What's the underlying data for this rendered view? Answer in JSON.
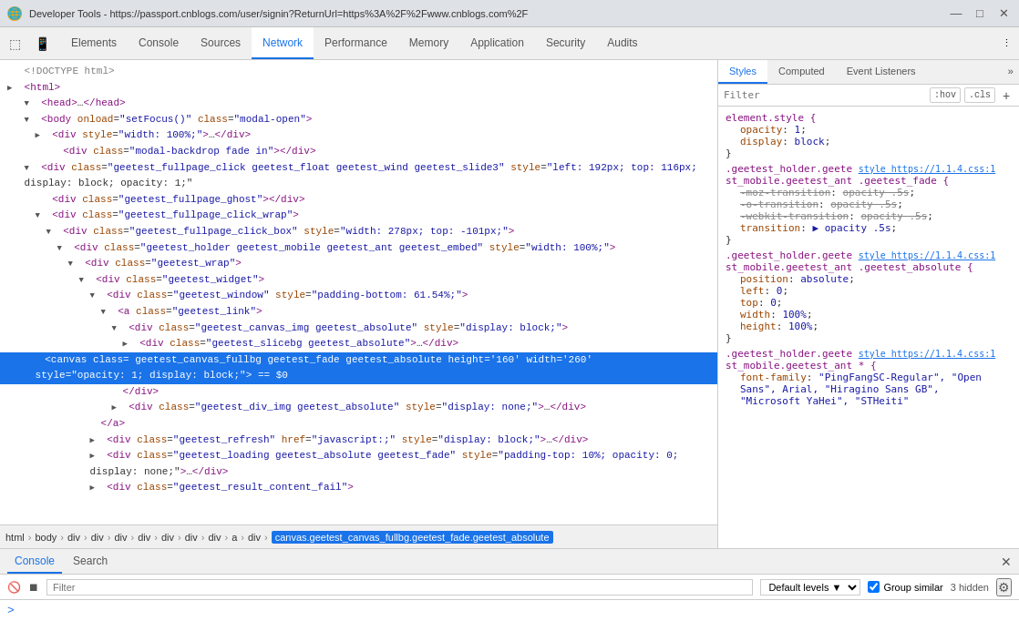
{
  "titlebar": {
    "title": "Developer Tools - https://passport.cnblogs.com/user/signin?ReturnUrl=https%3A%2F%2Fwww.cnblogs.com%2F",
    "icon": "🔵",
    "min_btn": "—",
    "max_btn": "□",
    "close_btn": "✕"
  },
  "tabs": {
    "items": [
      {
        "label": "Elements",
        "active": false
      },
      {
        "label": "Console",
        "active": false
      },
      {
        "label": "Sources",
        "active": false
      },
      {
        "label": "Network",
        "active": true
      },
      {
        "label": "Performance",
        "active": false
      },
      {
        "label": "Memory",
        "active": false
      },
      {
        "label": "Application",
        "active": false
      },
      {
        "label": "Security",
        "active": false
      },
      {
        "label": "Audits",
        "active": false
      }
    ],
    "more_icon": "⋮"
  },
  "dom": {
    "lines": [
      {
        "id": 1,
        "indent": 0,
        "triangle": "empty",
        "content": "&lt;!DOCTYPE html&gt;",
        "selected": false
      },
      {
        "id": 2,
        "indent": 0,
        "triangle": "closed",
        "content": "<span class='tag'>&lt;html&gt;</span>",
        "selected": false
      },
      {
        "id": 3,
        "indent": 0,
        "triangle": "open",
        "content": "<span class='tag'>▼ &lt;head&gt;</span><span class='text-node'>…</span><span class='tag'>&lt;/head&gt;</span>",
        "selected": false
      },
      {
        "id": 4,
        "indent": 0,
        "triangle": "open",
        "content": "<span class='tag'>▼ &lt;body</span> <span class='attr-name'>onload</span>=<span class='attr-value'>\"setFocus()\"</span> <span class='attr-name'>class</span>=<span class='attr-value'>\"modal-open\"</span><span class='tag'>&gt;</span>",
        "selected": false
      },
      {
        "id": 5,
        "indent": 1,
        "triangle": "closed",
        "content": "<span class='tag'>▶ &lt;div</span> <span class='attr-name'>style</span>=<span class='attr-value'>\"width: 100%;\"&gt;</span><span class='text-node'>…</span><span class='tag'>&lt;/div&gt;</span>",
        "selected": false
      },
      {
        "id": 6,
        "indent": 2,
        "triangle": "empty",
        "content": "<span class='tag'>&lt;div</span> <span class='attr-name'>class</span>=<span class='attr-value'>\"modal-backdrop fade in\"</span><span class='tag'>&gt;&lt;/div&gt;</span>",
        "selected": false
      },
      {
        "id": 7,
        "indent": 1,
        "triangle": "open",
        "content": "<span class='tag'>▼ &lt;div</span> <span class='attr-name'>class</span>=<span class='attr-value'>\"geetest_fullpage_click geetest_float geetest_wind geetest_slide3\"</span> <span class='attr-name'>style</span>=<span class='attr-value'>\"left: 192px; top: 116px;</span>",
        "selected": false
      },
      {
        "id": 7,
        "indent": 2,
        "triangle": "empty",
        "content": "<span class='text-node'>display: block; opacity: 1;\"</span>",
        "selected": false
      },
      {
        "id": 8,
        "indent": 2,
        "triangle": "empty",
        "content": "<span class='tag'>&lt;div</span> <span class='attr-name'>class</span>=<span class='attr-value'>\"geetest_fullpage_ghost\"</span><span class='tag'>&gt;&lt;/div&gt;</span>",
        "selected": false
      },
      {
        "id": 9,
        "indent": 2,
        "triangle": "open",
        "content": "<span class='tag'>▼ &lt;div</span> <span class='attr-name'>class</span>=<span class='attr-value'>\"geetest_fullpage_click_wrap\"</span><span class='tag'>&gt;</span>",
        "selected": false
      },
      {
        "id": 10,
        "indent": 3,
        "triangle": "open",
        "content": "<span class='tag'>▼ &lt;div</span> <span class='attr-name'>class</span>=<span class='attr-value'>\"geetest_fullpage_click_box\"</span> <span class='attr-name'>style</span>=<span class='attr-value'>\"width: 278px; top: -101px;\"</span><span class='tag'>&gt;</span>",
        "selected": false
      },
      {
        "id": 11,
        "indent": 4,
        "triangle": "open",
        "content": "<span class='tag'>▼ &lt;div</span> <span class='attr-name'>class</span>=<span class='attr-value'>\"geetest_holder geetest_mobile geetest_ant geetest_embed\"</span> <span class='attr-name'>style</span>=<span class='attr-value'>\"width: 100%;\"</span><span class='tag'>&gt;</span>",
        "selected": false
      },
      {
        "id": 12,
        "indent": 5,
        "triangle": "open",
        "content": "<span class='tag'>▼ &lt;div</span> <span class='attr-name'>class</span>=<span class='attr-value'>\"geetest_wrap\"</span><span class='tag'>&gt;</span>",
        "selected": false
      },
      {
        "id": 13,
        "indent": 6,
        "triangle": "open",
        "content": "<span class='tag'>▼ &lt;div</span> <span class='attr-name'>class</span>=<span class='attr-value'>\"geetest_widget\"</span><span class='tag'>&gt;</span>",
        "selected": false
      },
      {
        "id": 14,
        "indent": 7,
        "triangle": "open",
        "content": "<span class='tag'>▼ &lt;div</span> <span class='attr-name'>class</span>=<span class='attr-value'>\"geetest_window\"</span> <span class='attr-name'>style</span>=<span class='attr-value'>\"padding-bottom: 61.54%;\"</span><span class='tag'>&gt;</span>",
        "selected": false
      },
      {
        "id": 15,
        "indent": 8,
        "triangle": "open",
        "content": "<span class='tag'>▼ &lt;a</span> <span class='attr-name'>class</span>=<span class='attr-value'>\"geetest_link\"</span><span class='tag'>&gt;</span>",
        "selected": false
      },
      {
        "id": 16,
        "indent": 9,
        "triangle": "open",
        "content": "<span class='tag'>▼ &lt;div</span> <span class='attr-name'>class</span>=<span class='attr-value'>\"geetest_canvas_img geetest_absolute\"</span> <span class='attr-name'>style</span>=<span class='attr-value'>\"display: block;\"</span><span class='tag'>&gt;</span>",
        "selected": false
      },
      {
        "id": 17,
        "indent": 10,
        "triangle": "closed",
        "content": "<span class='tag'>▶ &lt;div</span> <span class='attr-name'>class</span>=<span class='attr-value'>\"geetest_slicebg geetest_absolute\"</span><span class='tag'>&gt;</span><span class='text-node'>…</span><span class='tag'>&lt;/div&gt;</span>",
        "selected": false
      },
      {
        "id": 18,
        "indent": 9,
        "triangle": "empty",
        "content": "<span class='tag'>&lt;canvas</span> <span class='attr-name'>class</span>=<span class='attr-value'>\"geetest_canvas_fullbg geetest_fade geetest_absolute\"</span> <span class='attr-name'>height</span>=<span class='attr-value'>\"160\"</span> <span class='attr-name'>width</span>=<span class='attr-value'>\"260\"</span>",
        "selected": true
      },
      {
        "id": 19,
        "indent": 10,
        "triangle": "empty",
        "content": "<span class='attr-name'>style</span>=<span class='attr-value'>\"opacity: 1; display: block;\"</span><span class='tag'>&gt;</span> <span class='text-node'>== $0</span>",
        "selected": true
      },
      {
        "id": 20,
        "indent": 9,
        "triangle": "empty",
        "content": "<span class='tag'>&lt;/div&gt;</span>",
        "selected": false
      },
      {
        "id": 21,
        "indent": 9,
        "triangle": "closed",
        "content": "<span class='tag'>▶ &lt;div</span> <span class='attr-name'>class</span>=<span class='attr-value'>\"geetest_div_img geetest_absolute\"</span> <span class='attr-name'>style</span>=<span class='attr-value'>\"display: none;\"</span><span class='tag'>&gt;</span><span class='text-node'>…</span><span class='tag'>&lt;/div&gt;</span>",
        "selected": false
      },
      {
        "id": 22,
        "indent": 8,
        "triangle": "empty",
        "content": "<span class='tag'>&lt;/a&gt;</span>",
        "selected": false
      },
      {
        "id": 23,
        "indent": 8,
        "triangle": "closed",
        "content": "<span class='tag'>▶ &lt;div</span> <span class='attr-name'>class</span>=<span class='attr-value'>\"geetest_refresh\"</span> <span class='attr-name'>href</span>=<span class='attr-value'>\"javascript:;\"</span> <span class='attr-name'>style</span>=<span class='attr-value'>\"display: block;\"</span><span class='tag'>&gt;</span><span class='text-node'>…</span><span class='tag'>&lt;/div&gt;</span>",
        "selected": false
      },
      {
        "id": 24,
        "indent": 8,
        "triangle": "closed",
        "content": "<span class='tag'>▶ &lt;div</span> <span class='attr-name'>class</span>=<span class='attr-value'>\"geetest_loading geetest_absolute geetest_fade\"</span> <span class='attr-name'>style</span>=<span class='attr-value'>\"padding-top: 10%; opacity: 0;</span>",
        "selected": false
      },
      {
        "id": 25,
        "indent": 9,
        "triangle": "empty",
        "content": "<span class='text-node'>display: none;\"</span><span class='tag'>&gt;</span><span class='text-node'>…</span><span class='tag'>&lt;/div&gt;</span>",
        "selected": false
      },
      {
        "id": 26,
        "indent": 8,
        "triangle": "closed",
        "content": "<span class='tag'>▶ &lt;div</span> <span class='attr-name'>class</span>=<span class='attr-value'>\"geetest_result_content_fail\"</span><span class='tag'>&gt;</span>",
        "selected": false
      }
    ]
  },
  "breadcrumb": {
    "items": [
      "html",
      "body",
      "div",
      "div",
      "div",
      "div",
      "div",
      "div",
      "div",
      "a",
      "div"
    ],
    "selected": "canvas.geetest_canvas_fullbg.geetest_fade.geetest_absolute"
  },
  "styles": {
    "tabs": [
      "Styles",
      "Computed",
      "Event Listeners"
    ],
    "active_tab": "Styles",
    "filter_placeholder": "Filter",
    "filter_options": [
      ":hov",
      ".cls"
    ],
    "rules": [
      {
        "selector": "element.style {",
        "source": "",
        "properties": [
          {
            "name": "opacity",
            "value": "1",
            "strikethrough": false
          },
          {
            "name": "display",
            "value": "block",
            "strikethrough": false
          }
        ],
        "closing": "}"
      },
      {
        "selector": ".geetest_holder.geete",
        "source_text": "style",
        "source_link": "https://1.1.4.css:1",
        "selector2": "st_mobile.geetest_ant .geetest_fade {",
        "properties": [
          {
            "name": "-moz-transition",
            "value": "opacity .5s",
            "strikethrough": true
          },
          {
            "name": "-o-transition",
            "value": "opacity .5s",
            "strikethrough": true
          },
          {
            "name": "-webkit-transition",
            "value": "opacity .5s",
            "strikethrough": true
          },
          {
            "name": "transition",
            "value": "▶ opacity .5s",
            "strikethrough": false
          }
        ],
        "closing": "}"
      },
      {
        "selector": ".geetest_holder.geete",
        "source_text": "style",
        "source_link": "https://1.1.4.css:1",
        "selector2": "st_mobile.geetest_ant .geetest_absolute {",
        "properties": [
          {
            "name": "position",
            "value": "absolute",
            "strikethrough": false
          },
          {
            "name": "left",
            "value": "0",
            "strikethrough": false
          },
          {
            "name": "top",
            "value": "0",
            "strikethrough": false
          },
          {
            "name": "width",
            "value": "100%",
            "strikethrough": false
          },
          {
            "name": "height",
            "value": "100%",
            "strikethrough": false
          }
        ],
        "closing": "}"
      },
      {
        "selector": ".geetest_holder.geete",
        "source_text": "style",
        "source_link": "https://1.1.4.css:1",
        "selector2": "st_mobile.geetest_ant * {",
        "properties": [
          {
            "name": "font-family",
            "value": "\"PingFangSC-Regular\", \"Open Sans\", Arial, \"Hiragino Sans GB\",",
            "strikethrough": false
          },
          {
            "name": "",
            "value": "\"Microsoft YaHei\", \"STHeiti\"",
            "strikethrough": false
          }
        ],
        "closing": ""
      }
    ]
  },
  "console": {
    "tabs": [
      "Console",
      "Search"
    ],
    "active_tab": "Console",
    "close_label": "✕",
    "clear_btn": "🚫",
    "execute_btn": "▶",
    "stop_btn": "⏹",
    "filter_placeholder": "Filter",
    "level_select": "Default levels",
    "level_arrow": "▼",
    "group_similar_label": "Group similar",
    "group_similar_checked": true,
    "hidden_count": "3 hidden",
    "gear_icon": "⚙",
    "prompt": ">",
    "input_value": ""
  }
}
